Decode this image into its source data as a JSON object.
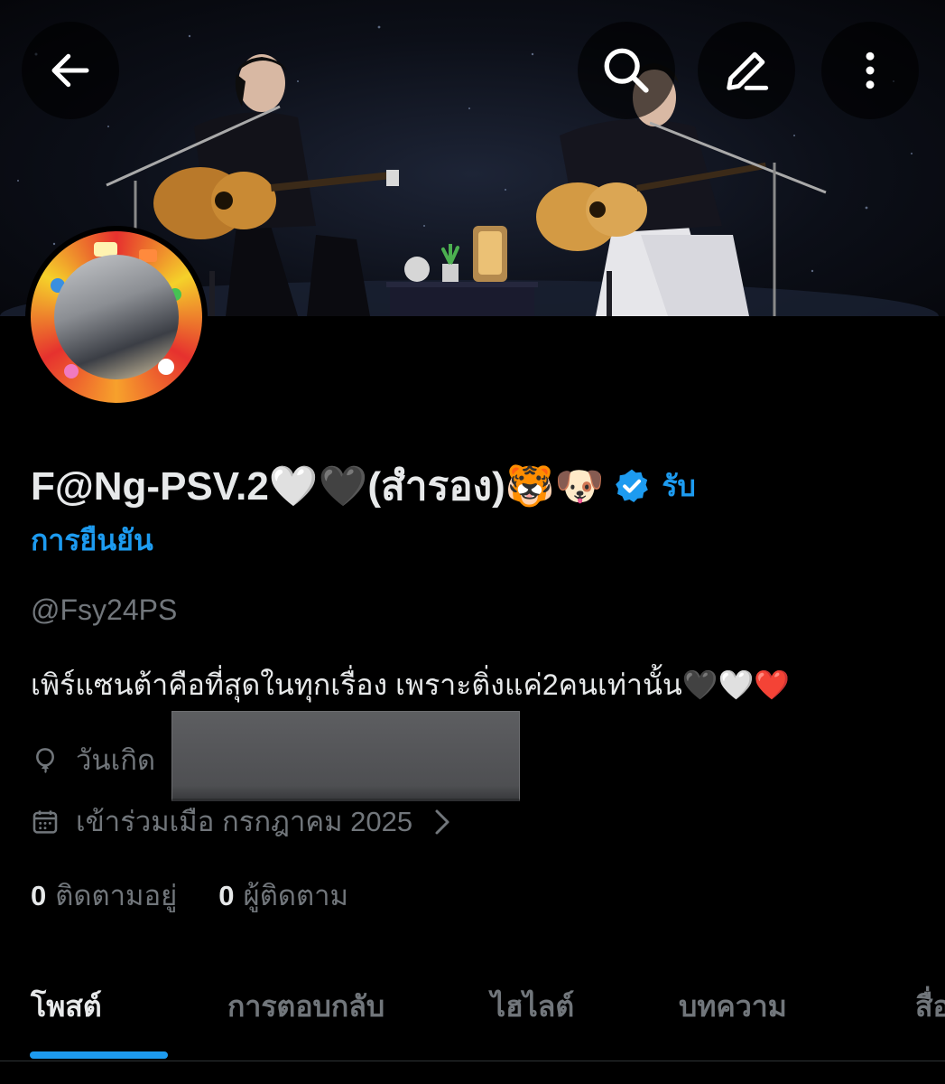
{
  "header": {
    "back_icon": "arrow-left-icon",
    "search_icon": "search-icon",
    "edit_icon": "pencil-icon",
    "more_icon": "more-vertical-icon"
  },
  "profile": {
    "display_name": "F@Ng-PSV.2🤍🖤(สำรอง)🐯🐶",
    "verified_icon": "verified-badge-icon",
    "verify_link_part1": "รับ",
    "verify_link_part2": "การยืนยัน",
    "handle": "@Fsy24PS",
    "bio": "เพิร์แซนต้าคือที่สุดในทุกเรื่อง เพราะติ่งแค่2คนเท่านั้น🖤🤍❤️",
    "birthday_label": "วันเกิด",
    "joined": "เข้าร่วมเมือ กรกฎาคม 2025",
    "following_count": "0",
    "following_label": "ติดตามอยู่",
    "followers_count": "0",
    "followers_label": "ผู้ติดตาม"
  },
  "tabs": [
    {
      "label": "โพสต์",
      "active": true
    },
    {
      "label": "การตอบกลับ",
      "active": false
    },
    {
      "label": "ไฮไลต์",
      "active": false
    },
    {
      "label": "บทความ",
      "active": false
    },
    {
      "label": "สื่อ",
      "active": false
    }
  ],
  "colors": {
    "accent": "#1d9bf0",
    "background": "#000000",
    "text_primary": "#e7e9ea",
    "text_secondary": "#71767b"
  }
}
